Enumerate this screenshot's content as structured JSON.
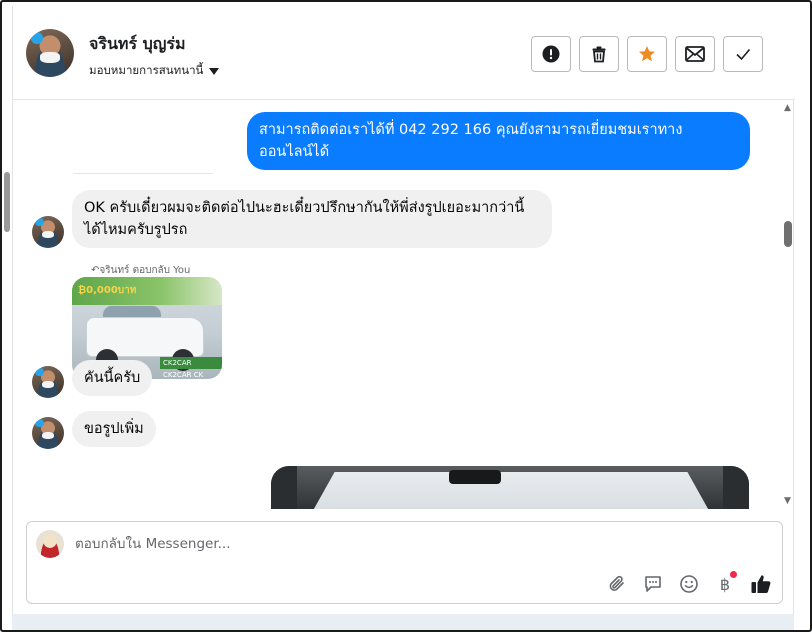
{
  "header": {
    "contact_name": "จรินทร์ บุญร่ม",
    "assign_label": "มอบหมายการสนทนานี้"
  },
  "toolbar": {
    "buttons": [
      {
        "name": "spam-button",
        "icon": "alert-circle-icon"
      },
      {
        "name": "delete-button",
        "icon": "trash-icon"
      },
      {
        "name": "star-button",
        "icon": "star-icon",
        "color": "#f08a24"
      },
      {
        "name": "mark-unread-button",
        "icon": "envelope-icon"
      },
      {
        "name": "mark-done-button",
        "icon": "checkmark-icon"
      }
    ]
  },
  "messages": [
    {
      "direction": "outgoing",
      "lines": [
        "สามารถติดต่อเราได้ที่ 042 292 166 คุณยังสามารถเยี่ยมชมเราทาง",
        "ออนไลน์ได้"
      ]
    },
    {
      "direction": "incoming",
      "lines": [
        "OK ครับเดี๋ยวผมจะติดต่อไปนะฮะเดี๋ยวปรึกษากันให้พี่ส่งรูปเยอะมากว่านี้",
        "ได้ไหมครับรูปรถ"
      ]
    },
    {
      "direction": "incoming",
      "reply_label": "จรินทร์ ตอบกลับ You",
      "image": "pickup-truck-ad"
    },
    {
      "direction": "incoming",
      "lines": [
        "คันนี้ครับ"
      ]
    },
    {
      "direction": "incoming",
      "lines": [
        "ขอรูปเพิ่ม"
      ]
    },
    {
      "direction": "outgoing",
      "image": "car-interior-photo"
    }
  ],
  "image_text": {
    "banner": "₿0,000บาท",
    "strip": "CK2CAR CK2CAR CK"
  },
  "composer": {
    "placeholder": "ตอบกลับใน Messenger...",
    "tools": [
      "paperclip-icon",
      "chat-bubble-icon",
      "smiley-icon",
      "baht-icon",
      "thumbs-up-icon"
    ],
    "baht_symbol": "฿"
  },
  "colors": {
    "outgoing_bubble": "#0a7cff",
    "incoming_bubble": "#f0f0f0",
    "star": "#f08a24",
    "notification_dot": "#f0284a"
  }
}
